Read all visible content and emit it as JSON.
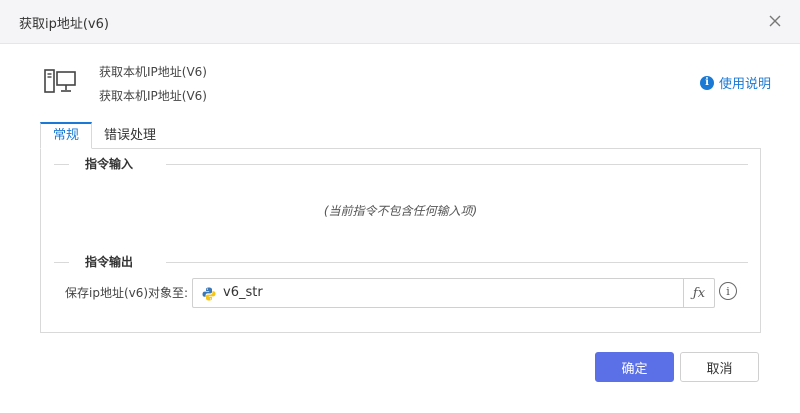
{
  "dialog": {
    "title": "获取ip地址(v6)"
  },
  "command": {
    "name": "获取本机IP地址(V6)",
    "description": "获取本机IP地址(V6)",
    "help_label": "使用说明"
  },
  "tabs": [
    {
      "label": "常规",
      "active": true
    },
    {
      "label": "错误处理",
      "active": false
    }
  ],
  "input_section": {
    "title": "指令输入",
    "empty_text": "(当前指令不包含任何输入项)"
  },
  "output_section": {
    "title": "指令输出",
    "save_label": "保存ip地址(v6)对象至:",
    "variable_value": "v6_str",
    "fx_label": "ƒx",
    "info_label": "i"
  },
  "buttons": {
    "ok": "确定",
    "cancel": "取消"
  },
  "colors": {
    "accent": "#1a79d4",
    "primary_button": "#5b6fe6"
  },
  "icons": [
    "close-icon",
    "computer-icon",
    "info-circle-icon",
    "python-icon",
    "fx-icon"
  ]
}
